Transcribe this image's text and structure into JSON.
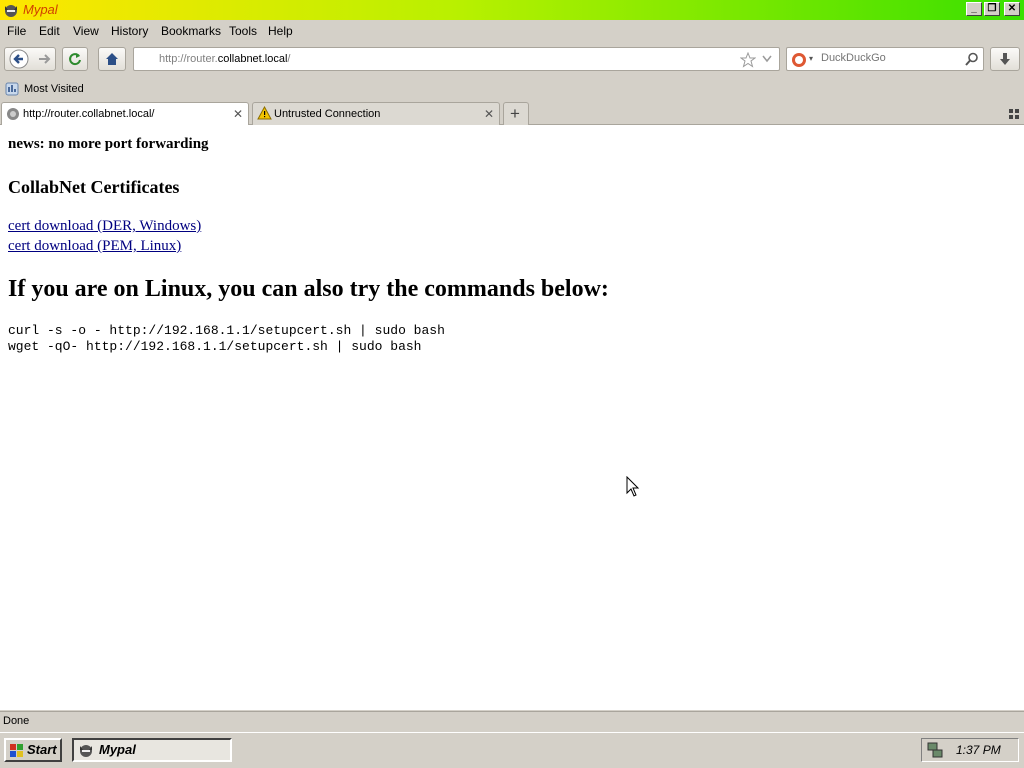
{
  "window": {
    "title": "Mypal"
  },
  "menu": [
    "File",
    "Edit",
    "View",
    "History",
    "Bookmarks",
    "Tools",
    "Help"
  ],
  "toolbar": {
    "url_prefix": "http://router.",
    "url_domain": "collabnet.local",
    "url_suffix": "/",
    "search_placeholder": "DuckDuckGo"
  },
  "bookmarks": {
    "most_visited": "Most Visited"
  },
  "tabs": [
    {
      "label": "http://router.collabnet.local/",
      "active": true
    },
    {
      "label": "Untrusted Connection",
      "active": false
    }
  ],
  "page": {
    "news": "news: no more port forwarding",
    "certs_heading": "CollabNet Certificates",
    "links": [
      "cert download (DER, Windows)",
      "cert download (PEM, Linux)"
    ],
    "linux_heading": "If you are on Linux, you can also try the commands below:",
    "commands": [
      "curl -s -o - http://192.168.1.1/setupcert.sh | sudo bash",
      "wget -qO- http://192.168.1.1/setupcert.sh | sudo bash"
    ]
  },
  "status": {
    "text": "Done"
  },
  "taskbar": {
    "start_label": "Start",
    "task_label": "Mypal",
    "clock": "1:37 PM"
  },
  "colors": {
    "link": "#000080",
    "title_text": "#d04000"
  }
}
